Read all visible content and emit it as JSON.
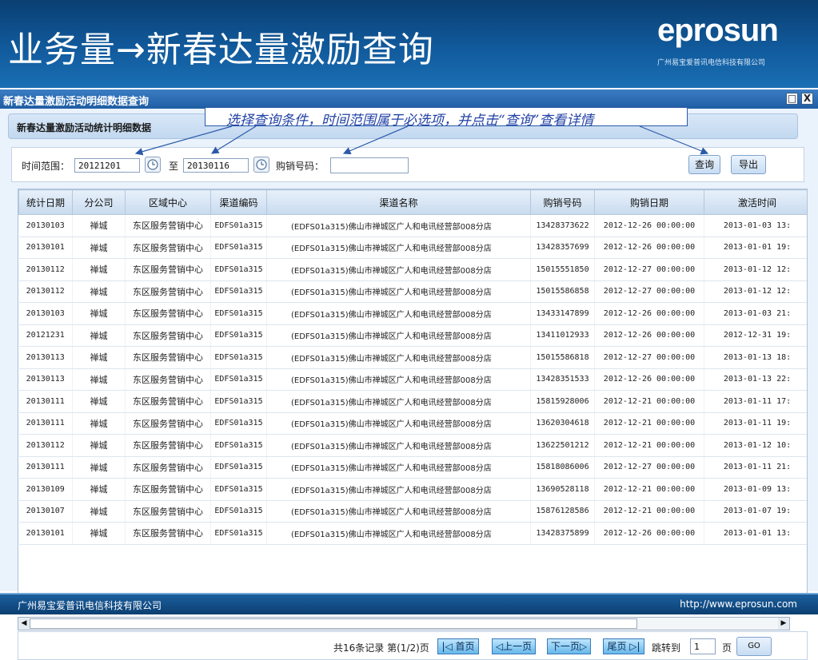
{
  "slide": {
    "title": "业务量→新春达量激励查询",
    "logo": "eprosun",
    "logo_subtitle": "广州易宝爱普讯电信科技有限公司",
    "footer_left": "广州易宝爱普讯电信科技有限公司",
    "footer_right": "http://www.eprosun.com"
  },
  "panel": {
    "title": "新春达量激励活动明细数据查询",
    "subtitle": "新春达量激励活动统计明细数据",
    "callout": "选择查询条件，时间范围属于必选项，并点击“查询”查看详情",
    "controls": {
      "minimize": "□",
      "close": "X"
    }
  },
  "filter": {
    "time_range_label": "时间范围：",
    "start_date": "20121201",
    "to_label": "至",
    "end_date": "20130116",
    "phone_label": "购销号码：",
    "phone_value": "",
    "query_button": "查询",
    "export_button": "导出"
  },
  "table": {
    "columns": [
      "统计日期",
      "分公司",
      "区域中心",
      "渠道编码",
      "渠道名称",
      "购销号码",
      "购销日期",
      "激活时间"
    ],
    "rows": [
      [
        "20130103",
        "禅城",
        "东区服务营销中心",
        "EDFS01a315",
        "(EDFS01a315)佛山市禅城区广人和电讯经营部008分店",
        "13428373622",
        "2012-12-26 00:00:00",
        "2013-01-03 13:"
      ],
      [
        "20130101",
        "禅城",
        "东区服务营销中心",
        "EDFS01a315",
        "(EDFS01a315)佛山市禅城区广人和电讯经营部008分店",
        "13428357699",
        "2012-12-26 00:00:00",
        "2013-01-01 19:"
      ],
      [
        "20130112",
        "禅城",
        "东区服务营销中心",
        "EDFS01a315",
        "(EDFS01a315)佛山市禅城区广人和电讯经营部008分店",
        "15015551850",
        "2012-12-27 00:00:00",
        "2013-01-12 12:"
      ],
      [
        "20130112",
        "禅城",
        "东区服务营销中心",
        "EDFS01a315",
        "(EDFS01a315)佛山市禅城区广人和电讯经营部008分店",
        "15015586858",
        "2012-12-27 00:00:00",
        "2013-01-12 12:"
      ],
      [
        "20130103",
        "禅城",
        "东区服务营销中心",
        "EDFS01a315",
        "(EDFS01a315)佛山市禅城区广人和电讯经营部008分店",
        "13433147899",
        "2012-12-26 00:00:00",
        "2013-01-03 21:"
      ],
      [
        "20121231",
        "禅城",
        "东区服务营销中心",
        "EDFS01a315",
        "(EDFS01a315)佛山市禅城区广人和电讯经营部008分店",
        "13411012933",
        "2012-12-26 00:00:00",
        "2012-12-31 19:"
      ],
      [
        "20130113",
        "禅城",
        "东区服务营销中心",
        "EDFS01a315",
        "(EDFS01a315)佛山市禅城区广人和电讯经营部008分店",
        "15015586818",
        "2012-12-27 00:00:00",
        "2013-01-13 18:"
      ],
      [
        "20130113",
        "禅城",
        "东区服务营销中心",
        "EDFS01a315",
        "(EDFS01a315)佛山市禅城区广人和电讯经营部008分店",
        "13428351533",
        "2012-12-26 00:00:00",
        "2013-01-13 22:"
      ],
      [
        "20130111",
        "禅城",
        "东区服务营销中心",
        "EDFS01a315",
        "(EDFS01a315)佛山市禅城区广人和电讯经营部008分店",
        "15815928006",
        "2012-12-21 00:00:00",
        "2013-01-11 17:"
      ],
      [
        "20130111",
        "禅城",
        "东区服务营销中心",
        "EDFS01a315",
        "(EDFS01a315)佛山市禅城区广人和电讯经营部008分店",
        "13620304618",
        "2012-12-21 00:00:00",
        "2013-01-11 19:"
      ],
      [
        "20130112",
        "禅城",
        "东区服务营销中心",
        "EDFS01a315",
        "(EDFS01a315)佛山市禅城区广人和电讯经营部008分店",
        "13622501212",
        "2012-12-21 00:00:00",
        "2013-01-12 10:"
      ],
      [
        "20130111",
        "禅城",
        "东区服务营销中心",
        "EDFS01a315",
        "(EDFS01a315)佛山市禅城区广人和电讯经营部008分店",
        "15818086006",
        "2012-12-27 00:00:00",
        "2013-01-11 21:"
      ],
      [
        "20130109",
        "禅城",
        "东区服务营销中心",
        "EDFS01a315",
        "(EDFS01a315)佛山市禅城区广人和电讯经营部008分店",
        "13690528118",
        "2012-12-21 00:00:00",
        "2013-01-09 13:"
      ],
      [
        "20130107",
        "禅城",
        "东区服务营销中心",
        "EDFS01a315",
        "(EDFS01a315)佛山市禅城区广人和电讯经营部008分店",
        "15876128586",
        "2012-12-21 00:00:00",
        "2013-01-07 19:"
      ],
      [
        "20130101",
        "禅城",
        "东区服务营销中心",
        "EDFS01a315",
        "(EDFS01a315)佛山市禅城区广人和电讯经营部008分店",
        "13428375899",
        "2012-12-26 00:00:00",
        "2013-01-01 13:"
      ]
    ]
  },
  "pager": {
    "summary": "共16条记录 第(1/2)页",
    "first": "|◁ 首页",
    "prev": "◁上一页",
    "next": "下一页▷",
    "last": "尾页 ▷|",
    "jump_label": "跳转到",
    "page_value": "1",
    "page_suffix": "页",
    "go": "GO"
  },
  "colors": {
    "header_blue": "#115a9c",
    "callout_blue": "#2142a6",
    "pager_button": "#67b8ea"
  }
}
